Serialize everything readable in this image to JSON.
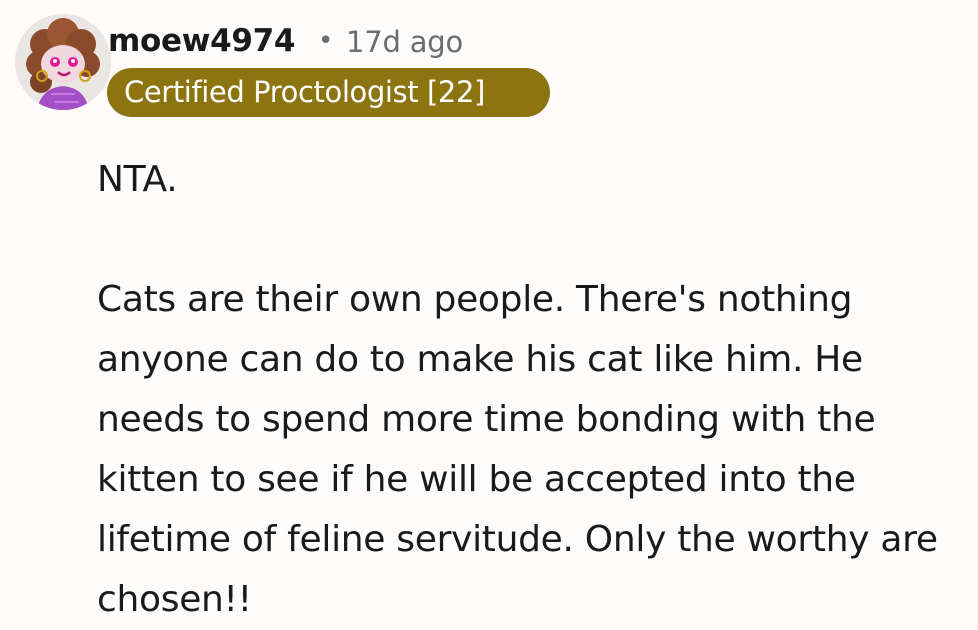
{
  "comment": {
    "avatar_icon": "snoo-avatar-icon",
    "username": "moew4974",
    "separator": "•",
    "timestamp": "17d ago",
    "flair": {
      "text": "Certified Proctologist [22]",
      "color": "#8c7410"
    },
    "paragraphs": [
      "NTA.",
      "Cats are their own people. There's nothing\nanyone can do to make his cat like him. He\nneeds to spend more time bonding with the\nkitten to see if he will be accepted into the\nlifetime of feline servitude. Only the worthy are\nchosen!!"
    ]
  }
}
